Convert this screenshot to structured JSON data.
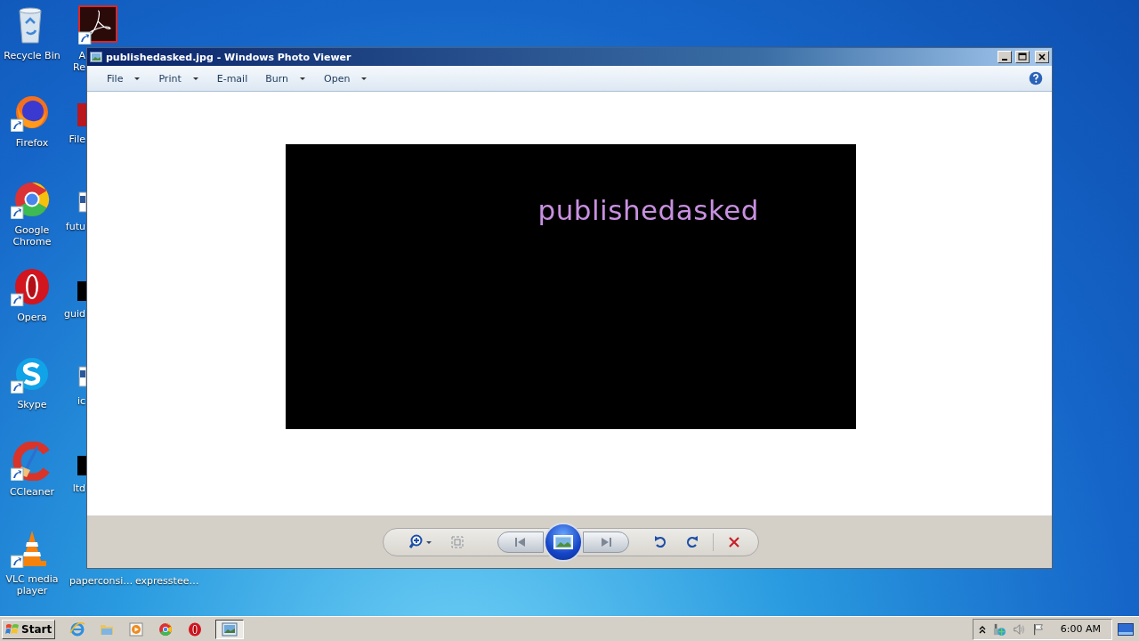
{
  "desktop": {
    "column_1": [
      {
        "label": "Recycle Bin",
        "kind": "recycle"
      },
      {
        "label": "Firefox",
        "kind": "firefox"
      },
      {
        "label": "Google Chrome",
        "kind": "chrome"
      },
      {
        "label": "Opera",
        "kind": "opera"
      },
      {
        "label": "Skype",
        "kind": "skype"
      },
      {
        "label": "CCleaner",
        "kind": "ccleaner"
      },
      {
        "label": "VLC media player",
        "kind": "vlc"
      }
    ],
    "column_2": [
      {
        "label": "A Re",
        "kind": "acrobat"
      },
      {
        "label": "File",
        "kind": "red"
      },
      {
        "label": "futu",
        "kind": "doc"
      },
      {
        "label": "guid",
        "kind": "black"
      },
      {
        "label": "ic",
        "kind": "doc"
      },
      {
        "label": "ltd",
        "kind": "black"
      }
    ],
    "bottom_row": [
      {
        "label": "paperconsi…"
      },
      {
        "label": "expresstee…"
      }
    ]
  },
  "window": {
    "title": "publishedasked.jpg - Windows Photo Viewer",
    "menu": [
      {
        "label": "File",
        "dropdown": true
      },
      {
        "label": "Print",
        "dropdown": true
      },
      {
        "label": "E-mail",
        "dropdown": false
      },
      {
        "label": "Burn",
        "dropdown": true
      },
      {
        "label": "Open",
        "dropdown": true
      }
    ],
    "image": {
      "text": "publishedasked"
    }
  },
  "taskbar": {
    "start": "Start",
    "quick_launch": [
      {
        "kind": "ie"
      },
      {
        "kind": "folder"
      },
      {
        "kind": "media"
      },
      {
        "kind": "chrome"
      },
      {
        "kind": "opera"
      }
    ],
    "clock": "6:00 AM"
  }
}
